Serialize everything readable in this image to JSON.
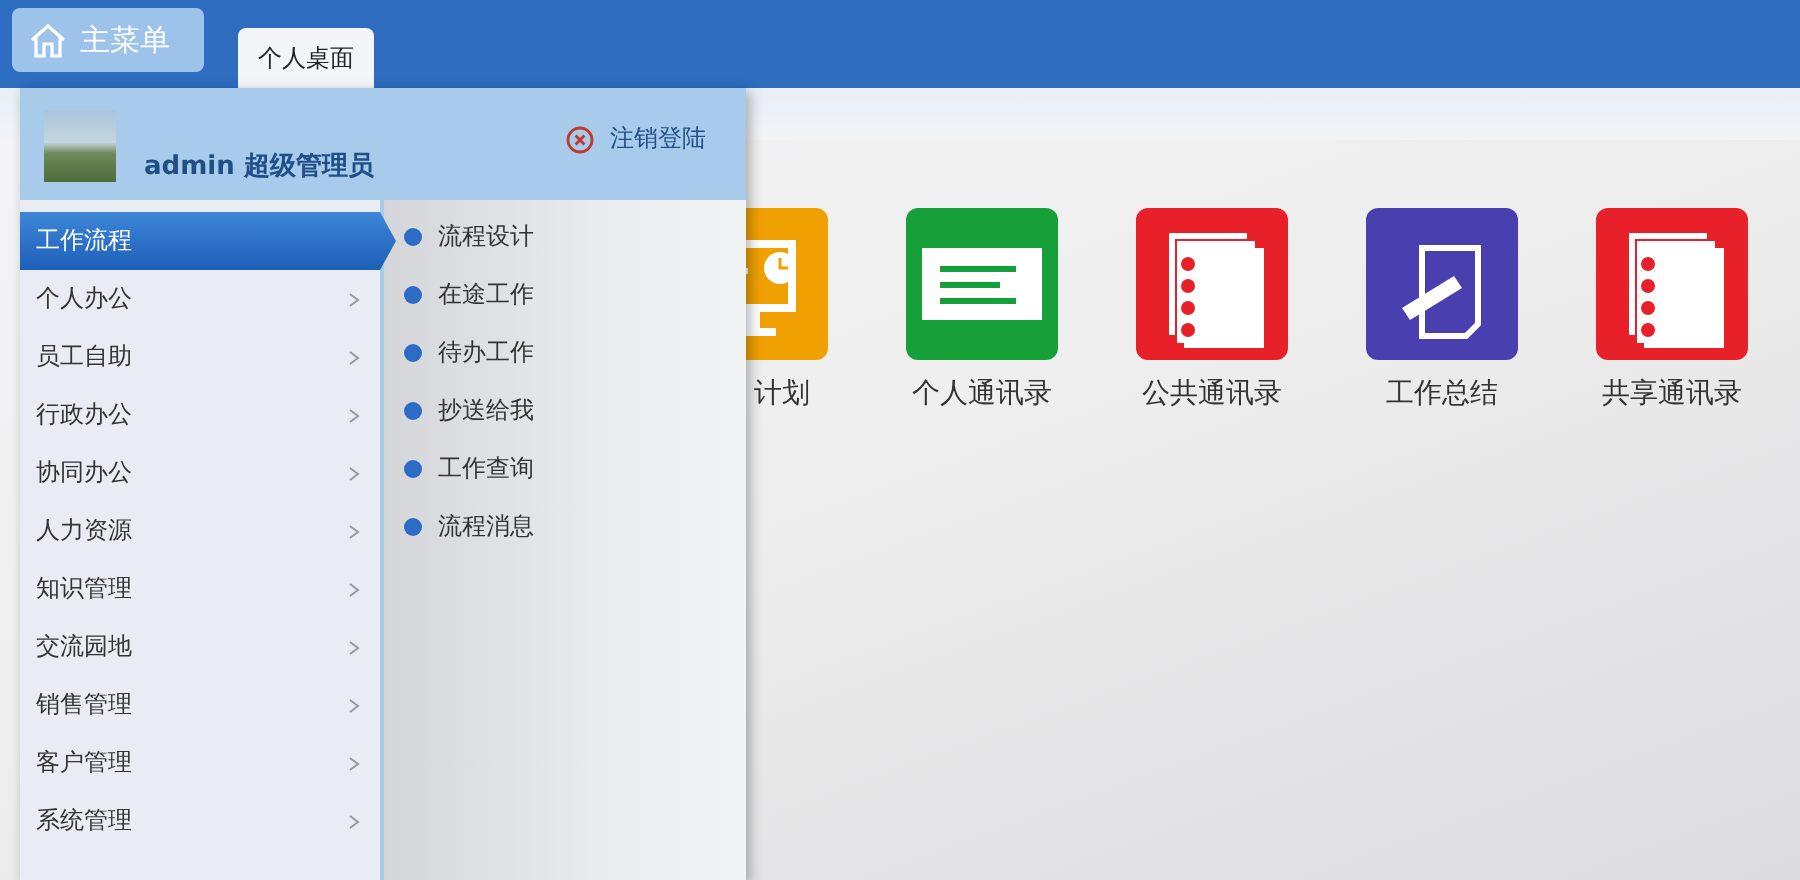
{
  "main_menu": {
    "label": "主菜单"
  },
  "tabs": [
    {
      "label": "个人桌面",
      "selected": true
    }
  ],
  "user": {
    "name": "admin",
    "role": "超级管理员",
    "logout": "注销登陆"
  },
  "menu_items": [
    {
      "label": "工作流程",
      "selected": true
    },
    {
      "label": "个人办公",
      "selected": false
    },
    {
      "label": "员工自助",
      "selected": false
    },
    {
      "label": "行政办公",
      "selected": false
    },
    {
      "label": "协同办公",
      "selected": false
    },
    {
      "label": "人力资源",
      "selected": false
    },
    {
      "label": "知识管理",
      "selected": false
    },
    {
      "label": "交流园地",
      "selected": false
    },
    {
      "label": "销售管理",
      "selected": false
    },
    {
      "label": "客户管理",
      "selected": false
    },
    {
      "label": "系统管理",
      "selected": false
    }
  ],
  "submenu_items": [
    "流程设计",
    "在途工作",
    "待办工作",
    "抄送给我",
    "工作查询",
    "流程消息"
  ],
  "apps": [
    {
      "label": "计划",
      "kind": "monitor",
      "color": "#f0a000",
      "partial": true
    },
    {
      "label": "个人通讯录",
      "kind": "card",
      "color": "#17a03a"
    },
    {
      "label": "公共通讯录",
      "kind": "notebook",
      "color": "#e8202a"
    },
    {
      "label": "工作总结",
      "kind": "note",
      "color": "#4a3fae"
    },
    {
      "label": "共享通讯录",
      "kind": "notebook",
      "color": "#e8202a"
    }
  ]
}
